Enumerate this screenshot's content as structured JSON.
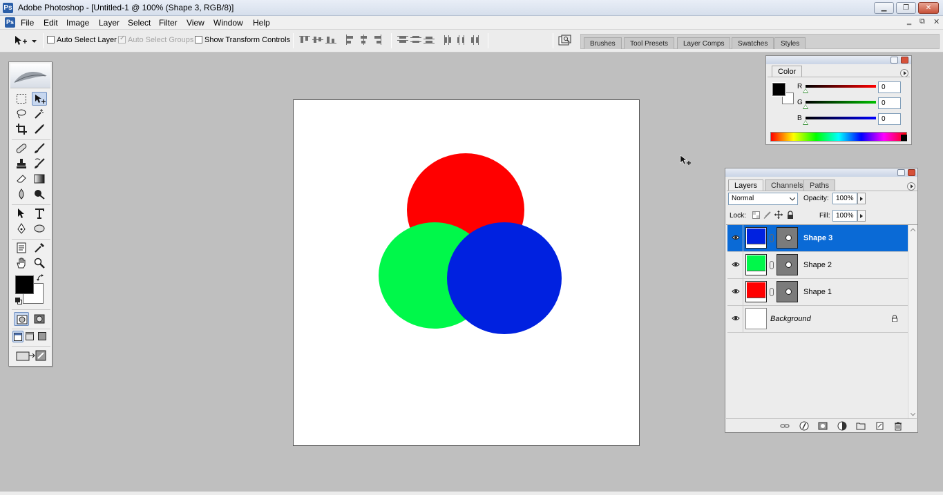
{
  "window": {
    "title": "Adobe Photoshop - [Untitled-1 @ 100% (Shape 3, RGB/8)]",
    "app_icon": "Ps",
    "buttons": {
      "minimize": "▁",
      "restore": "❐",
      "close": "✕"
    },
    "doc_buttons": {
      "minimize": "‗",
      "restore": "⧉",
      "close": "✕"
    }
  },
  "menu": {
    "items": [
      "File",
      "Edit",
      "Image",
      "Layer",
      "Select",
      "Filter",
      "View",
      "Window",
      "Help"
    ]
  },
  "options_bar": {
    "auto_select_layer": {
      "label": "Auto Select Layer",
      "checked": false
    },
    "auto_select_groups": {
      "label": "Auto Select Groups",
      "checked": true,
      "disabled": true
    },
    "show_transform_controls": {
      "label": "Show Transform Controls",
      "checked": false
    }
  },
  "palette_well": {
    "tabs": [
      "Brushes",
      "Tool Presets",
      "Layer Comps",
      "Swatches",
      "Styles"
    ]
  },
  "toolbox": {
    "foreground_color": "#000000",
    "background_color": "#ffffff"
  },
  "canvas": {
    "background": "#ffffff",
    "shapes": [
      {
        "name": "Shape 1",
        "color": "#ff0000"
      },
      {
        "name": "Shape 2",
        "color": "#00f84a"
      },
      {
        "name": "Shape 3",
        "color": "#0021e0"
      }
    ]
  },
  "color_panel": {
    "tab": "Color",
    "channels": [
      {
        "label": "R",
        "value": "0",
        "color": "#ff0000"
      },
      {
        "label": "G",
        "value": "0",
        "color": "#00c000"
      },
      {
        "label": "B",
        "value": "0",
        "color": "#0000ff"
      }
    ]
  },
  "layers_panel": {
    "tabs": [
      "Layers",
      "Channels",
      "Paths"
    ],
    "blend_mode": "Normal",
    "opacity_label": "Opacity:",
    "opacity": "100%",
    "lock_label": "Lock:",
    "fill_label": "Fill:",
    "fill": "100%",
    "layers": [
      {
        "name": "Shape 3",
        "color": "#0021e0",
        "selected": true
      },
      {
        "name": "Shape 2",
        "color": "#00f84a",
        "selected": false
      },
      {
        "name": "Shape 1",
        "color": "#ff0000",
        "selected": false
      },
      {
        "name": "Background",
        "color": "#ffffff",
        "selected": false
      }
    ]
  }
}
